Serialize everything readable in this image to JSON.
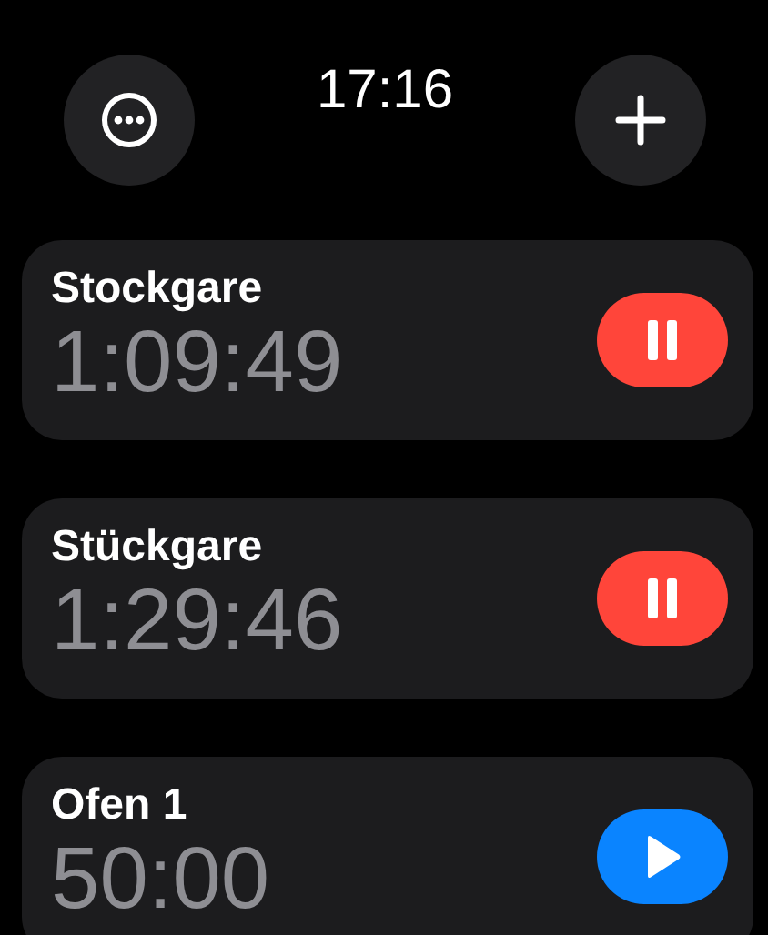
{
  "status_bar": {
    "time": "17:16"
  },
  "timers": [
    {
      "name": "Stockgare",
      "remaining": "1:09:49",
      "running": true
    },
    {
      "name": "Stückgare",
      "remaining": "1:29:46",
      "running": true
    },
    {
      "name": "Ofen 1",
      "remaining": "50:00",
      "running": false
    }
  ]
}
